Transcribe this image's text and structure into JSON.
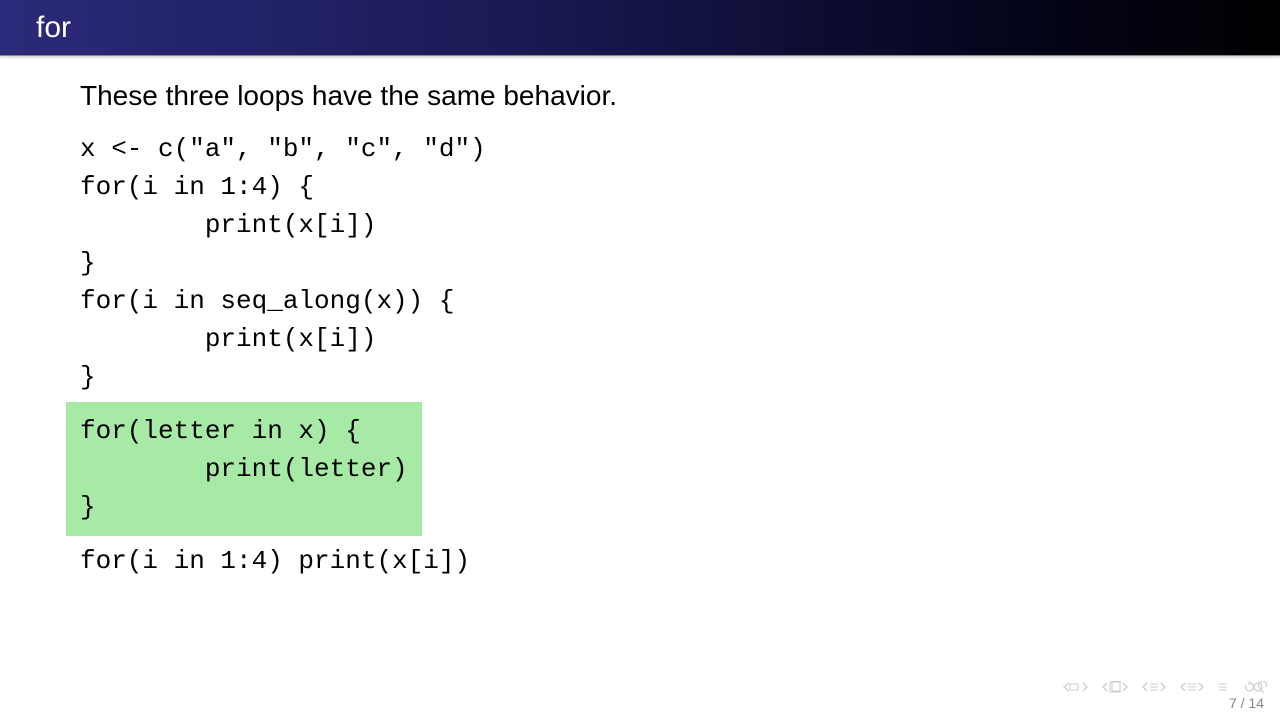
{
  "header": {
    "title": "for"
  },
  "intro": "These three loops have the same behavior.",
  "code": {
    "line1": "x <- c(\"a\", \"b\", \"c\", \"d\")",
    "blank1": "",
    "loop1_l1": "for(i in 1:4) {",
    "loop1_l2": "        print(x[i])",
    "loop1_l3": "}",
    "blank2": "",
    "loop2_l1": "for(i in seq_along(x)) {",
    "loop2_l2": "        print(x[i])",
    "loop2_l3": "}",
    "blank3": "",
    "loop3_l1": "for(letter in x) {",
    "loop3_l2": "        print(letter)",
    "loop3_l3": "}",
    "blank4": "",
    "loop4": "for(i in 1:4) print(x[i])"
  },
  "footer": {
    "page": "7 / 14"
  }
}
